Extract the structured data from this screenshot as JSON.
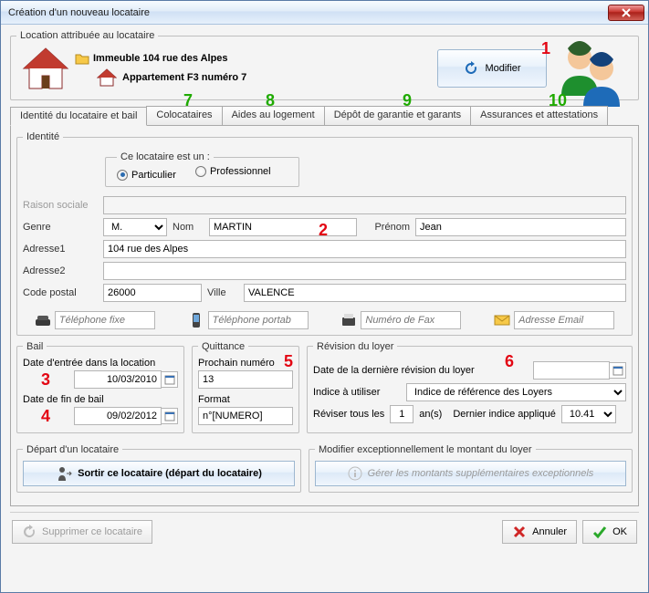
{
  "window": {
    "title": "Création d'un nouveau  locataire"
  },
  "location": {
    "legend": "Location attribuée au locataire",
    "building": "Immeuble 104 rue des Alpes",
    "unit": "Appartement F3 numéro 7",
    "modify_label": "Modifier"
  },
  "tabs": {
    "t1": "Identité du locataire et bail",
    "t2": "Colocataires",
    "t3": "Aides au logement",
    "t4": "Dépôt de garantie et garants",
    "t5": "Assurances et attestations"
  },
  "identity": {
    "legend": "Identité",
    "type_legend": "Ce locataire est un :",
    "type_particulier": "Particulier",
    "type_pro": "Professionnel",
    "raison_label": "Raison sociale",
    "raison_value": "",
    "genre_label": "Genre",
    "genre_value": "M.",
    "nom_label": "Nom",
    "nom_value": "MARTIN",
    "prenom_label": "Prénom",
    "prenom_value": "Jean",
    "adr1_label": "Adresse1",
    "adr1_value": "104 rue des Alpes",
    "adr2_label": "Adresse2",
    "adr2_value": "",
    "cp_label": "Code postal",
    "cp_value": "26000",
    "ville_label": "Ville",
    "ville_value": "VALENCE",
    "tel_fixe_ph": "Téléphone fixe",
    "tel_port_ph": "Téléphone portab",
    "fax_ph": "Numéro de Fax",
    "email_ph": "Adresse Email"
  },
  "bail": {
    "legend": "Bail",
    "date_entree_label": "Date d'entrée dans la location",
    "date_entree_value": "10/03/2010",
    "date_fin_label": "Date de fin de bail",
    "date_fin_value": "09/02/2012"
  },
  "quittance": {
    "legend": "Quittance",
    "prochain_label": "Prochain numéro",
    "prochain_value": "13",
    "format_label": "Format",
    "format_value": "n°[NUMERO]"
  },
  "revision": {
    "legend": "Révision du loyer",
    "date_label": "Date de la dernière révision du loyer",
    "date_value": "",
    "indice_label": "Indice à utiliser",
    "indice_value": "Indice de référence des Loyers",
    "reviser_label": "Réviser tous les",
    "reviser_value": "1",
    "reviser_unit": "an(s)",
    "dernier_label": "Dernier indice appliqué",
    "dernier_value": "10.41"
  },
  "depart": {
    "legend": "Départ d'un locataire",
    "btn": "Sortir ce locataire (départ du locataire)"
  },
  "except": {
    "legend": "Modifier exceptionnellement le montant du loyer",
    "btn": "Gérer les montants supplémentaires exceptionnels"
  },
  "footer": {
    "delete": "Supprimer ce locataire",
    "cancel": "Annuler",
    "ok": "OK"
  },
  "annotations": {
    "n1": "1",
    "n2": "2",
    "n3": "3",
    "n4": "4",
    "n5": "5",
    "n6": "6",
    "n7": "7",
    "n8": "8",
    "n9": "9",
    "n10": "10"
  }
}
